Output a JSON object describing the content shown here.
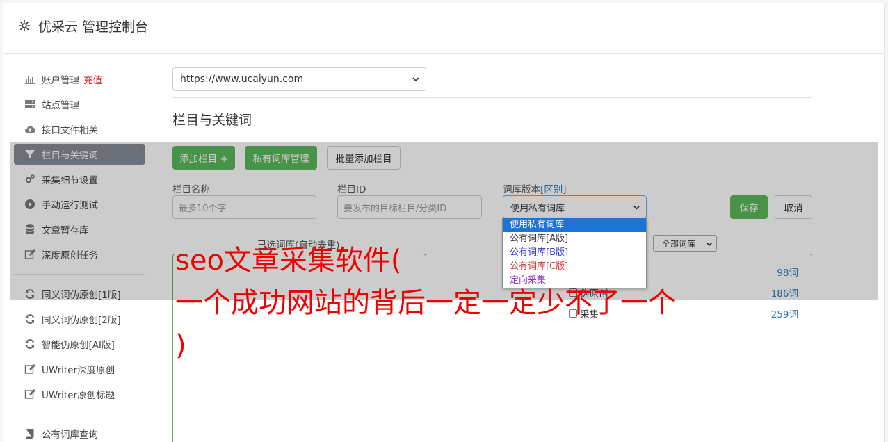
{
  "header": {
    "title": "优采云 管理控制台",
    "icon": "gear-icon"
  },
  "sidebar": {
    "items": [
      {
        "label": "账户管理",
        "badge": "充值",
        "icon": "bar-chart-icon"
      },
      {
        "label": "站点管理",
        "icon": "server-icon"
      },
      {
        "label": "接口文件相关",
        "icon": "cloud-upload-icon"
      },
      {
        "label": "栏目与关键词",
        "icon": "filter-icon",
        "active": true
      },
      {
        "label": "采集细节设置",
        "icon": "cogs-icon"
      },
      {
        "label": "手动运行测试",
        "icon": "play-icon"
      },
      {
        "label": "文章暂存库",
        "icon": "database-icon"
      },
      {
        "label": "深度原创任务",
        "icon": "edit-icon"
      },
      {
        "label": "同义词伪原创[1版]",
        "icon": "refresh-icon"
      },
      {
        "label": "同义词伪原创[2版]",
        "icon": "refresh-icon"
      },
      {
        "label": "智能伪原创[AI版]",
        "icon": "refresh-icon"
      },
      {
        "label": "UWriter深度原创",
        "icon": "edit-icon"
      },
      {
        "label": "UWriter原创标题",
        "icon": "edit-icon"
      },
      {
        "label": "公有词库查询",
        "icon": "book-icon"
      }
    ]
  },
  "main": {
    "site_select": "https://www.ucaiyun.com",
    "section_title": "栏目与关键词",
    "buttons": {
      "add_column": "添加栏目 +",
      "private_lib": "私有词库管理",
      "batch_add": "批量添加栏目",
      "save": "保存",
      "cancel": "取消"
    },
    "fields": {
      "name_label": "栏目名称",
      "name_placeholder": "最多10个字",
      "id_label": "栏目ID",
      "id_placeholder": "要发布的目标栏目/分类ID",
      "version_label": "词库版本",
      "version_diff_link": "[区别]",
      "version_value": "使用私有词库"
    },
    "version_options": [
      {
        "label": "使用私有词库",
        "color": "#ffffff",
        "selected": true
      },
      {
        "label": "公有词库[A版]",
        "color": "#333333"
      },
      {
        "label": "公有词库[B版]",
        "color": "#3333cc"
      },
      {
        "label": "公有词库[C版]",
        "color": "#cc3333"
      },
      {
        "label": "定向采集",
        "color": "#9933cc"
      }
    ],
    "selected_words_title": "已选词库(自动去重)",
    "lib_filter": "全部词库",
    "word_libs": [
      {
        "name": "",
        "count": "98词"
      },
      {
        "name": "伪原创",
        "count": "186词"
      },
      {
        "name": "采集",
        "count": "259词"
      }
    ]
  },
  "watermark": {
    "line1": "seo文章采集软件(",
    "line2": "一个成功网站的背后一定一定少不了一个",
    "line3": ")"
  }
}
